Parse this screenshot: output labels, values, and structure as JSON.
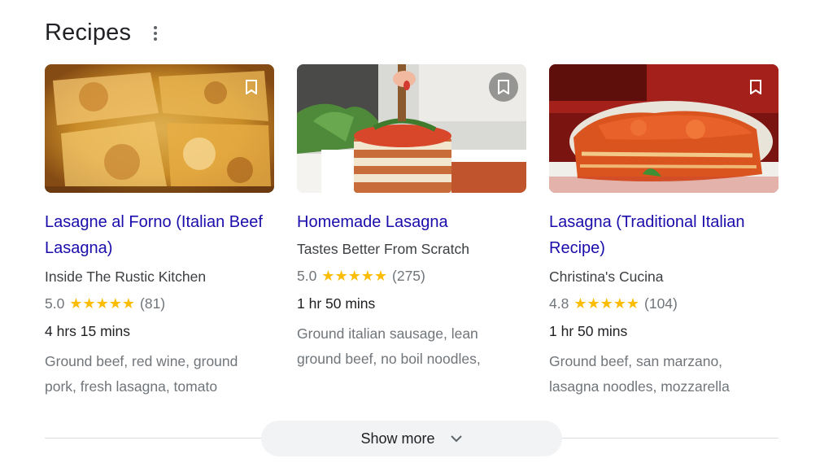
{
  "section": {
    "title": "Recipes"
  },
  "cards": [
    {
      "title": "Lasagne al Forno (Italian Beef Lasagna)",
      "source": "Inside The Rustic Kitchen",
      "rating": "5.0",
      "stars": "★★★★★",
      "count": "(81)",
      "time": "4 hrs 15 mins",
      "ingredients": "Ground beef, red wine, ground pork, fresh lasagna, tomato"
    },
    {
      "title": "Homemade Lasagna",
      "source": "Tastes Better From Scratch",
      "rating": "5.0",
      "stars": "★★★★★",
      "count": "(275)",
      "time": "1 hr 50 mins",
      "ingredients": "Ground italian sausage, lean ground beef, no boil noodles,"
    },
    {
      "title": "Lasagna (Traditional Italian Recipe)",
      "source": "Christina's Cucina",
      "rating": "4.8",
      "stars": "★★★★★",
      "count": "(104)",
      "time": "1 hr 50 mins",
      "ingredients": "Ground beef, san marzano, lasagna noodles, mozzarella"
    }
  ],
  "footer": {
    "show_more_label": "Show more"
  },
  "colors": {
    "link": "#1a0dab",
    "star": "#fbbc04",
    "muted": "#70757a"
  },
  "icons": {
    "menu": "more-vert-icon",
    "bookmark": "bookmark-icon",
    "expand": "chevron-down-icon"
  }
}
